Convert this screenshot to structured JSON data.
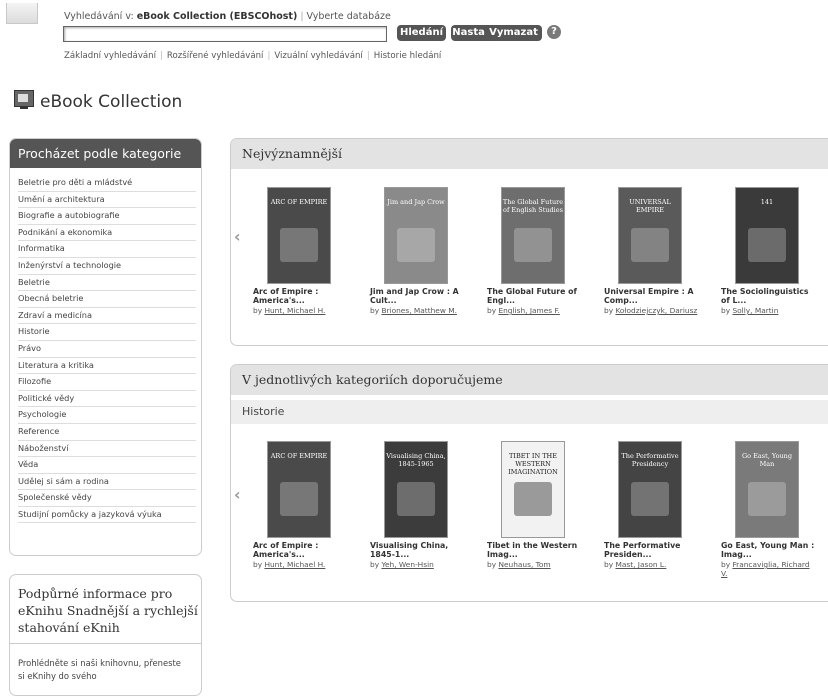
{
  "header": {
    "search_prefix": "Vyhledávání v:",
    "database": "eBook Collection (EBSCOhost)",
    "choose_db": "Vyberte databáze",
    "search_value": "",
    "buttons": {
      "search": "Hledání",
      "alert": "Nastavit alert",
      "clear": "Vymazat",
      "help": "?"
    },
    "links": [
      "Základní vyhledávání",
      "Rozšířené vyhledávání",
      "Vizuální vyhledávání",
      "Historie hledání"
    ]
  },
  "collection_title": "eBook Collection",
  "sidebar": {
    "title": "Procházet podle kategorie",
    "categories": [
      "Beletrie pro děti a mládstvé",
      "Umění a architektura",
      "Biografie a autobiografie",
      "Podnikání a ekonomika",
      "Informatika",
      "Inženýrství a technologie",
      "Beletrie",
      "Obecná beletrie",
      "Zdraví a medicína",
      "Historie",
      "Právo",
      "Literatura a kritika",
      "Filozofie",
      "Politické vědy",
      "Psychologie",
      "Reference",
      "Náboženství",
      "Věda",
      "Udělej si sám a rodina",
      "Společenské vědy",
      "Studijní pomůcky a jazyková výuka"
    ]
  },
  "support": {
    "title": "Podpůrné informace pro eKnihu Snadnější a rychlejší stahování eKnih",
    "text": "Prohlédněte si naši knihovnu, přeneste si eKnihy do svého"
  },
  "featured": {
    "title": "Nejvýznamnější",
    "books": [
      {
        "title": "Arc of Empire : America's...",
        "by": "by",
        "author": "Hunt, Michael H.",
        "cover_color": "#4a4a4a",
        "cover_text": "ARC OF EMPIRE"
      },
      {
        "title": "Jim and Jap Crow : A Cult...",
        "by": "by",
        "author": "Briones, Matthew M.",
        "cover_color": "#8a8a8a",
        "cover_text": "Jim and Jap Crow"
      },
      {
        "title": "The Global Future of Engl...",
        "by": "by",
        "author": "English, James F.",
        "cover_color": "#6e6e6e",
        "cover_text": "The Global Future of English Studies"
      },
      {
        "title": "Universal Empire : A Comp...",
        "by": "by",
        "author": "Kołodziejczyk, Dariusz",
        "cover_color": "#5a5a5a",
        "cover_text": "UNIVERSAL EMPIRE"
      },
      {
        "title": "The Sociolinguistics of L...",
        "by": "by",
        "author": "Solly, Martin",
        "cover_color": "#3a3a3a",
        "cover_text": "141"
      }
    ]
  },
  "recommended": {
    "title": "V jednotlivých kategoriích doporučujeme",
    "subtitle": "Historie",
    "books": [
      {
        "title": "Arc of Empire : America's...",
        "by": "by",
        "author": "Hunt, Michael H.",
        "cover_color": "#4a4a4a",
        "cover_text": "ARC OF EMPIRE"
      },
      {
        "title": "Visualising China, 1845-1...",
        "by": "by",
        "author": "Yeh, Wen-Hsin",
        "cover_color": "#3c3c3c",
        "cover_text": "Visualising China, 1845-1965"
      },
      {
        "title": "Tibet in the Western Imag...",
        "by": "by",
        "author": "Neuhaus, Tom",
        "cover_color": "#f2f2f2",
        "cover_text": "TIBET IN THE WESTERN IMAGINATION"
      },
      {
        "title": "The Performative Presiden...",
        "by": "by",
        "author": "Mast, Jason L.",
        "cover_color": "#444444",
        "cover_text": "The Performative Presidency"
      },
      {
        "title": "Go East, Young Man : Imag...",
        "by": "by",
        "author": "Francaviglia, Richard V.",
        "cover_color": "#7a7a7a",
        "cover_text": "Go East, Young Man"
      }
    ]
  }
}
